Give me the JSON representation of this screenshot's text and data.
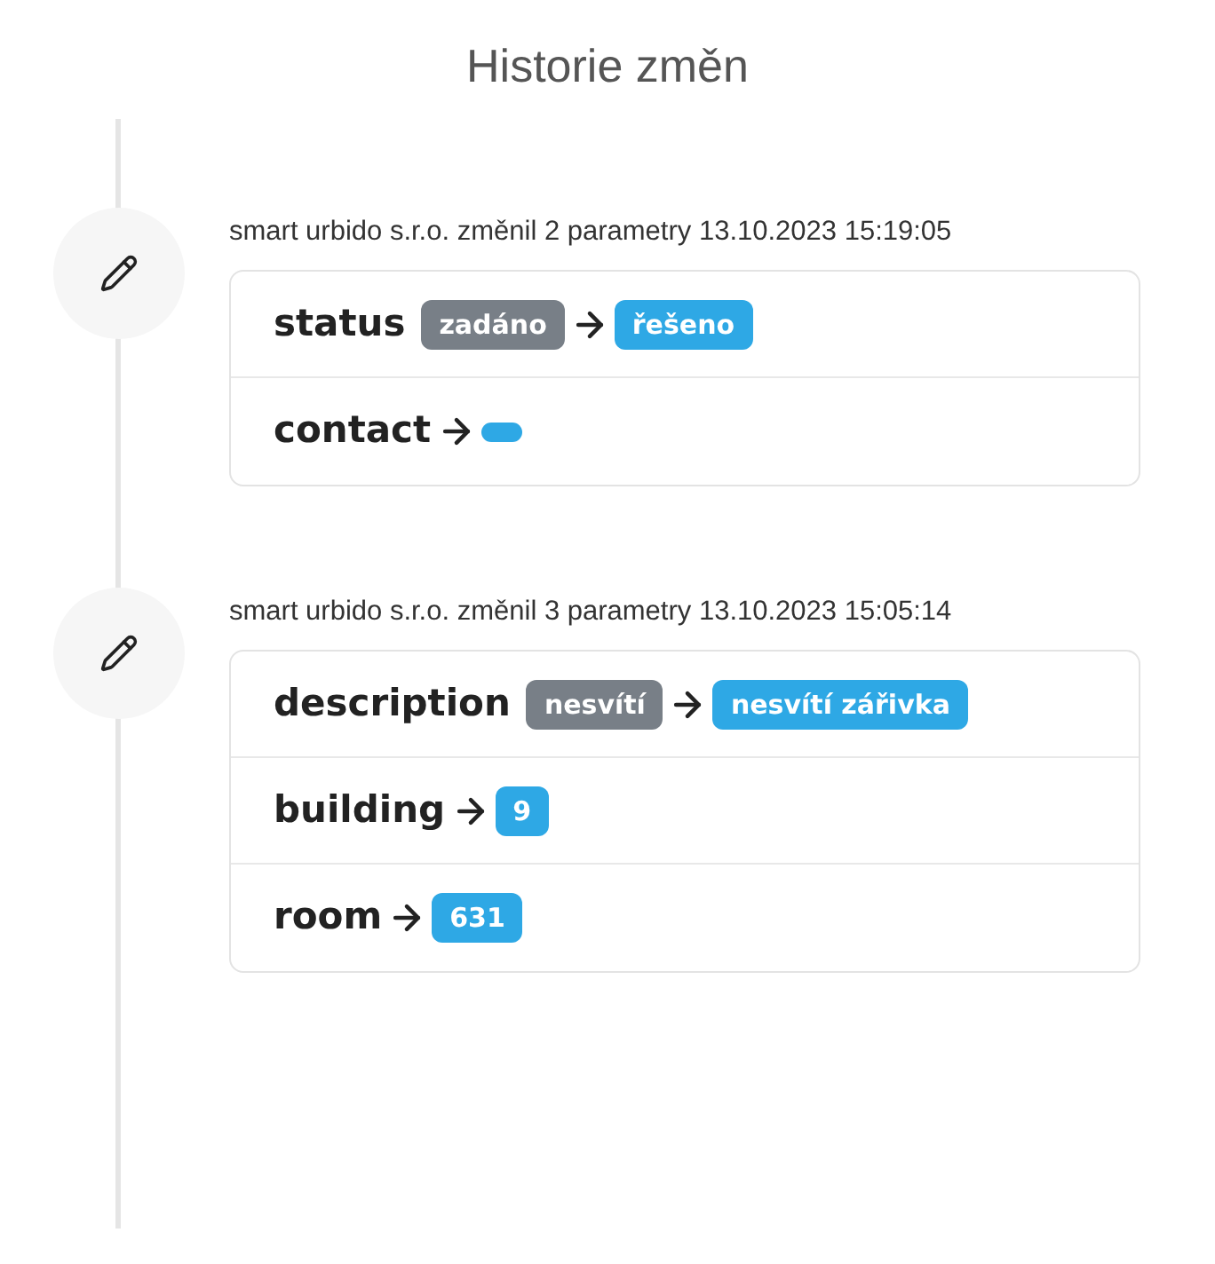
{
  "title": "Historie změn",
  "entries": [
    {
      "header": "smart urbido s.r.o. změnil 2 parametry 13.10.2023 15:19:05",
      "changes": [
        {
          "field": "status",
          "kind": "changed",
          "old": "zadáno",
          "new": "řešeno"
        },
        {
          "field": "contact",
          "kind": "set_empty"
        }
      ]
    },
    {
      "header": "smart urbido s.r.o. změnil 3 parametry 13.10.2023 15:05:14",
      "changes": [
        {
          "field": "description",
          "kind": "changed",
          "old": "nesvítí",
          "new": "nesvítí zářivka"
        },
        {
          "field": "building",
          "kind": "set",
          "new": "9"
        },
        {
          "field": "room",
          "kind": "set",
          "new": "631"
        }
      ]
    }
  ]
}
